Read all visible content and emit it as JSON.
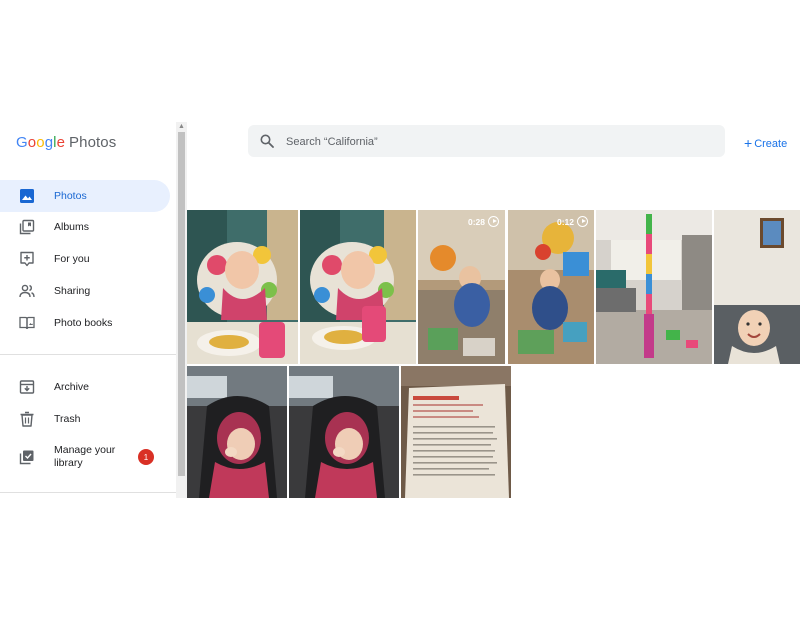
{
  "app": {
    "logo_letters": [
      "G",
      "o",
      "o",
      "g",
      "l",
      "e"
    ],
    "product": "Photos"
  },
  "search": {
    "placeholder": "Search “California”"
  },
  "create_label": "Create",
  "sidebar": {
    "items": [
      {
        "label": "Photos",
        "icon": "photo-icon",
        "active": true
      },
      {
        "label": "Albums",
        "icon": "albums-icon"
      },
      {
        "label": "For you",
        "icon": "for-you-icon"
      },
      {
        "label": "Sharing",
        "icon": "sharing-icon"
      },
      {
        "label": "Photo books",
        "icon": "photo-books-icon"
      }
    ],
    "secondary": [
      {
        "label": "Archive",
        "icon": "archive-icon"
      },
      {
        "label": "Trash",
        "icon": "trash-icon"
      },
      {
        "label": "Manage your library",
        "icon": "manage-library-icon",
        "badge": "1"
      }
    ]
  },
  "photos": [
    {
      "name": "baby-highchair-1"
    },
    {
      "name": "baby-highchair-2"
    },
    {
      "name": "toddler-playing-video-1",
      "duration": "0:28"
    },
    {
      "name": "toddler-playing-video-2",
      "duration": "0:12"
    },
    {
      "name": "block-tower-living-room"
    },
    {
      "name": "baby-smiling-sofa"
    },
    {
      "name": "baby-car-seat-1"
    },
    {
      "name": "baby-car-seat-2"
    },
    {
      "name": "book-page-recipe"
    }
  ],
  "colors": {
    "accent": "#1a73e8",
    "active_bg": "#e8f0fe",
    "badge": "#d93025"
  }
}
